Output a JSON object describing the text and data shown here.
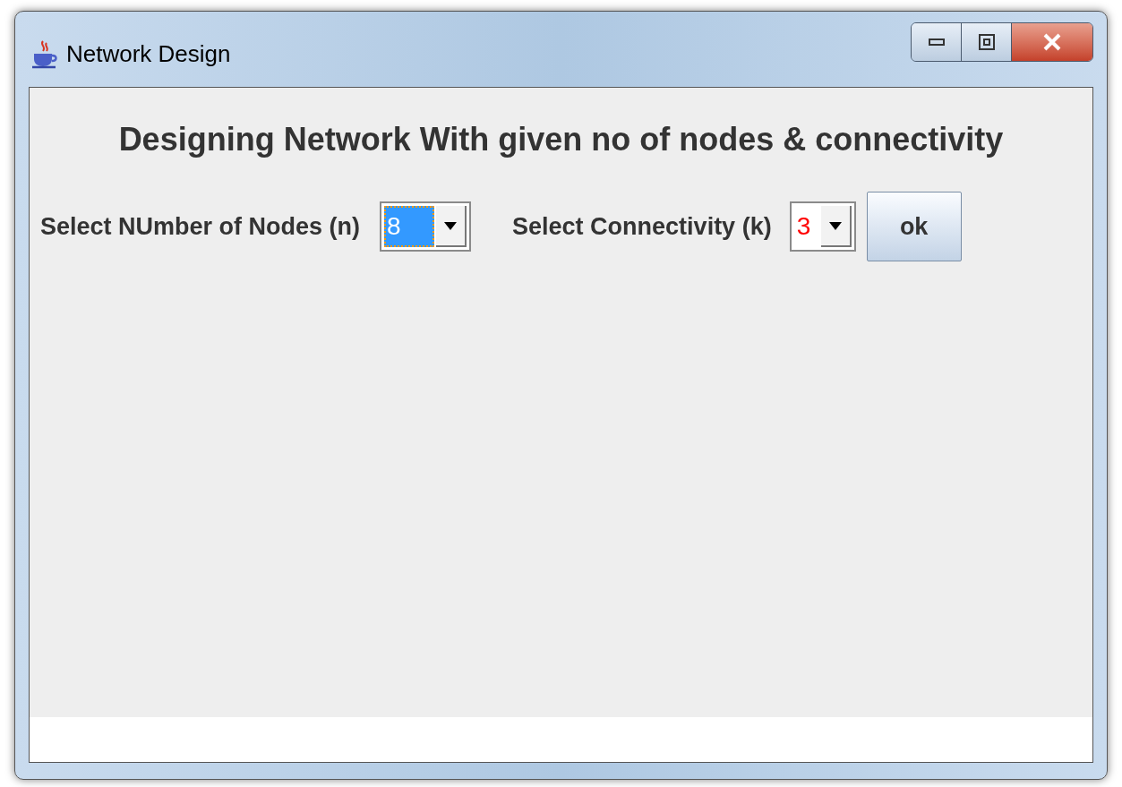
{
  "window": {
    "title": "Network Design"
  },
  "heading": "Designing Network With given no of nodes & connectivity",
  "controls": [
    {
      "label": "Select NUmber of Nodes (n)",
      "value": "8",
      "focused": true
    },
    {
      "label": "Select Connectivity (k)",
      "value": "3",
      "focused": false
    }
  ],
  "buttons": [
    "ok"
  ]
}
